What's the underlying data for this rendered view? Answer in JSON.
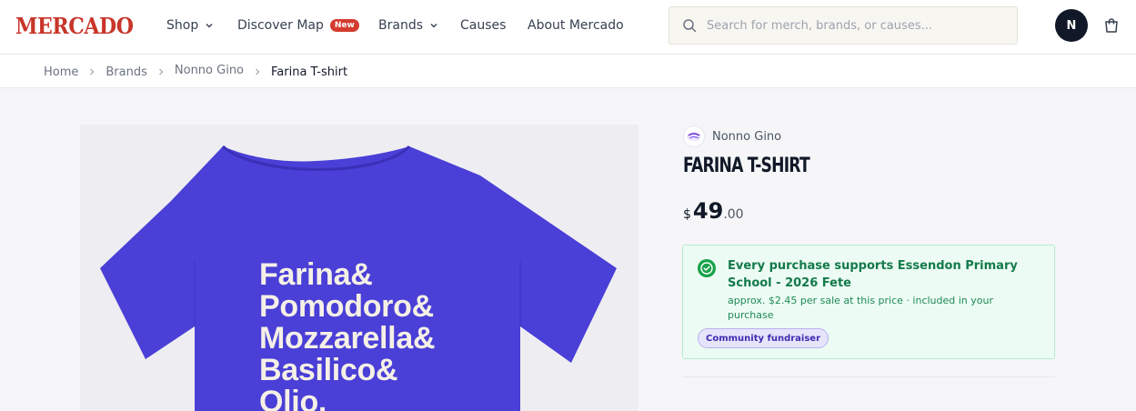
{
  "header": {
    "logo": "MERCADO",
    "nav": [
      {
        "label": "Shop",
        "has_dropdown": true
      },
      {
        "label": "Discover Map",
        "badge": "New"
      },
      {
        "label": "Brands",
        "has_dropdown": true
      },
      {
        "label": "Causes"
      },
      {
        "label": "About Mercado"
      }
    ],
    "search": {
      "placeholder": "Search for merch, brands, or causes..."
    },
    "avatar_initial": "N",
    "icons": {
      "search": "search-icon",
      "cart": "shopping-bag-icon",
      "chevron": "chevron-down-icon"
    }
  },
  "breadcrumb": [
    "Home",
    "Brands",
    "Nonno Gino",
    "Farina T-shirt"
  ],
  "product": {
    "brand": "Nonno Gino",
    "title": "Farina T-shirt",
    "price": {
      "currency": "$",
      "whole": "49",
      "cents": ".00"
    },
    "shirt_lines": [
      "Farina&",
      "Pomodoro&",
      "Mozzarella&",
      "Basilico&",
      "Olio."
    ],
    "shirt_color": "#4a3fd6",
    "support": {
      "title": "Every purchase supports Essendon Primary School - 2026 Fete",
      "subtitle": "approx. $2.45 per sale at this price · included in your purchase",
      "badge": "Community fundraiser"
    }
  },
  "colors": {
    "brand_red": "#c8352a",
    "support_bg": "#ecfbf3",
    "support_text": "#137a4b",
    "badge_purple": "#3b2bb0"
  }
}
